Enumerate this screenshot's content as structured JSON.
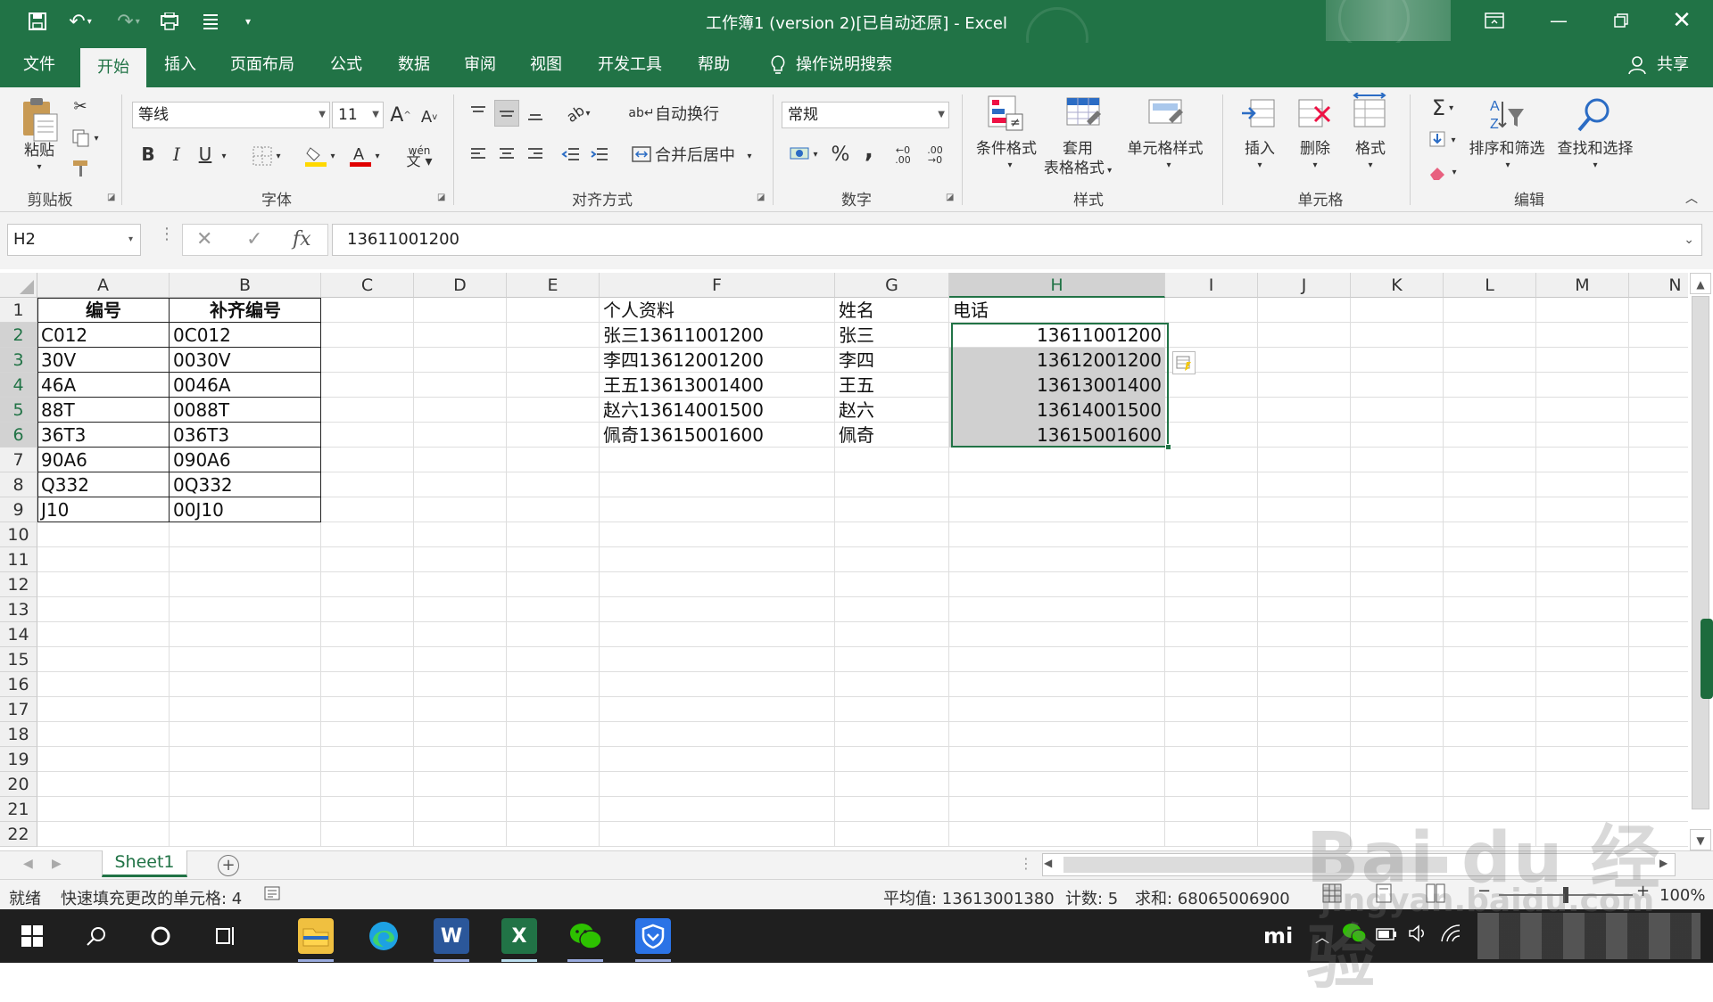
{
  "app": {
    "title": "工作簿1 (version 2)[已自动还原]  -  Excel",
    "share": "共享"
  },
  "tabs": [
    "文件",
    "开始",
    "插入",
    "页面布局",
    "公式",
    "数据",
    "审阅",
    "视图",
    "开发工具",
    "帮助",
    "操作说明搜索"
  ],
  "ribbon": {
    "clipboard": {
      "paste": "粘贴",
      "label": "剪贴板"
    },
    "font": {
      "name": "等线",
      "size": "11",
      "grow": "A",
      "shrink": "A",
      "bold": "B",
      "italic": "I",
      "underline": "U",
      "phonetic": "wén",
      "label": "字体"
    },
    "alignment": {
      "wrap": "自动换行",
      "merge": "合并后居中",
      "label": "对齐方式"
    },
    "number": {
      "format": "常规",
      "percent": "%",
      "comma": ",",
      "inc": "←0 .00",
      "dec": ".00 →0",
      "label": "数字"
    },
    "styles": {
      "cond": "条件格式",
      "table1": "套用",
      "table2": "表格格式",
      "cell": "单元格样式",
      "label": "样式"
    },
    "cells": {
      "insert": "插入",
      "delete": "删除",
      "format": "格式",
      "label": "单元格"
    },
    "editing": {
      "sort": "排序和筛选",
      "find": "查找和选择",
      "label": "编辑",
      "sum": "Σ"
    }
  },
  "formula_bar": {
    "name_box": "H2",
    "value": "13611001200",
    "fx": "fx"
  },
  "columns": [
    "A",
    "B",
    "C",
    "D",
    "E",
    "F",
    "G",
    "H",
    "I",
    "J",
    "K",
    "L",
    "M",
    "N"
  ],
  "rows": [
    "1",
    "2",
    "3",
    "4",
    "5",
    "6",
    "7",
    "8",
    "9",
    "10",
    "11",
    "12",
    "13",
    "14",
    "15",
    "16",
    "17",
    "18",
    "19",
    "20",
    "21",
    "22"
  ],
  "cells": {
    "A1": "编号",
    "B1": "补齐编号",
    "A2": "C012",
    "B2": "0C012",
    "A3": "30V",
    "B3": "0030V",
    "A4": "46A",
    "B4": "0046A",
    "A5": "88T",
    "B5": "0088T",
    "A6": "36T3",
    "B6": "036T3",
    "A7": "90A6",
    "B7": "090A6",
    "A8": "Q332",
    "B8": "0Q332",
    "A9": "J10",
    "B9": "00J10",
    "F1": "个人资料",
    "G1": "姓名",
    "H1": "电话",
    "F2": "张三13611001200",
    "G2": "张三",
    "H2": "13611001200",
    "F3": "李四13612001200",
    "G3": "李四",
    "H3": "13612001200",
    "F4": "王五13613001400",
    "G4": "王五",
    "H4": "13613001400",
    "F5": "赵六13614001500",
    "G5": "赵六",
    "H5": "13614001500",
    "F6": "佩奇13615001600",
    "G6": "佩奇",
    "H6": "13615001600"
  },
  "sheet": {
    "tab": "Sheet1",
    "add": "+"
  },
  "status": {
    "ready": "就绪",
    "flashfill": "快速填充更改的单元格: 4",
    "average": "平均值: 13613001380",
    "count": "计数: 5",
    "sum": "求和: 68065006900",
    "zoom": "100%"
  },
  "taskbar": {
    "word": "W",
    "excel": "X"
  },
  "watermark": {
    "logo": "Bai du 经验",
    "url": "jingyan.baidu.com"
  }
}
